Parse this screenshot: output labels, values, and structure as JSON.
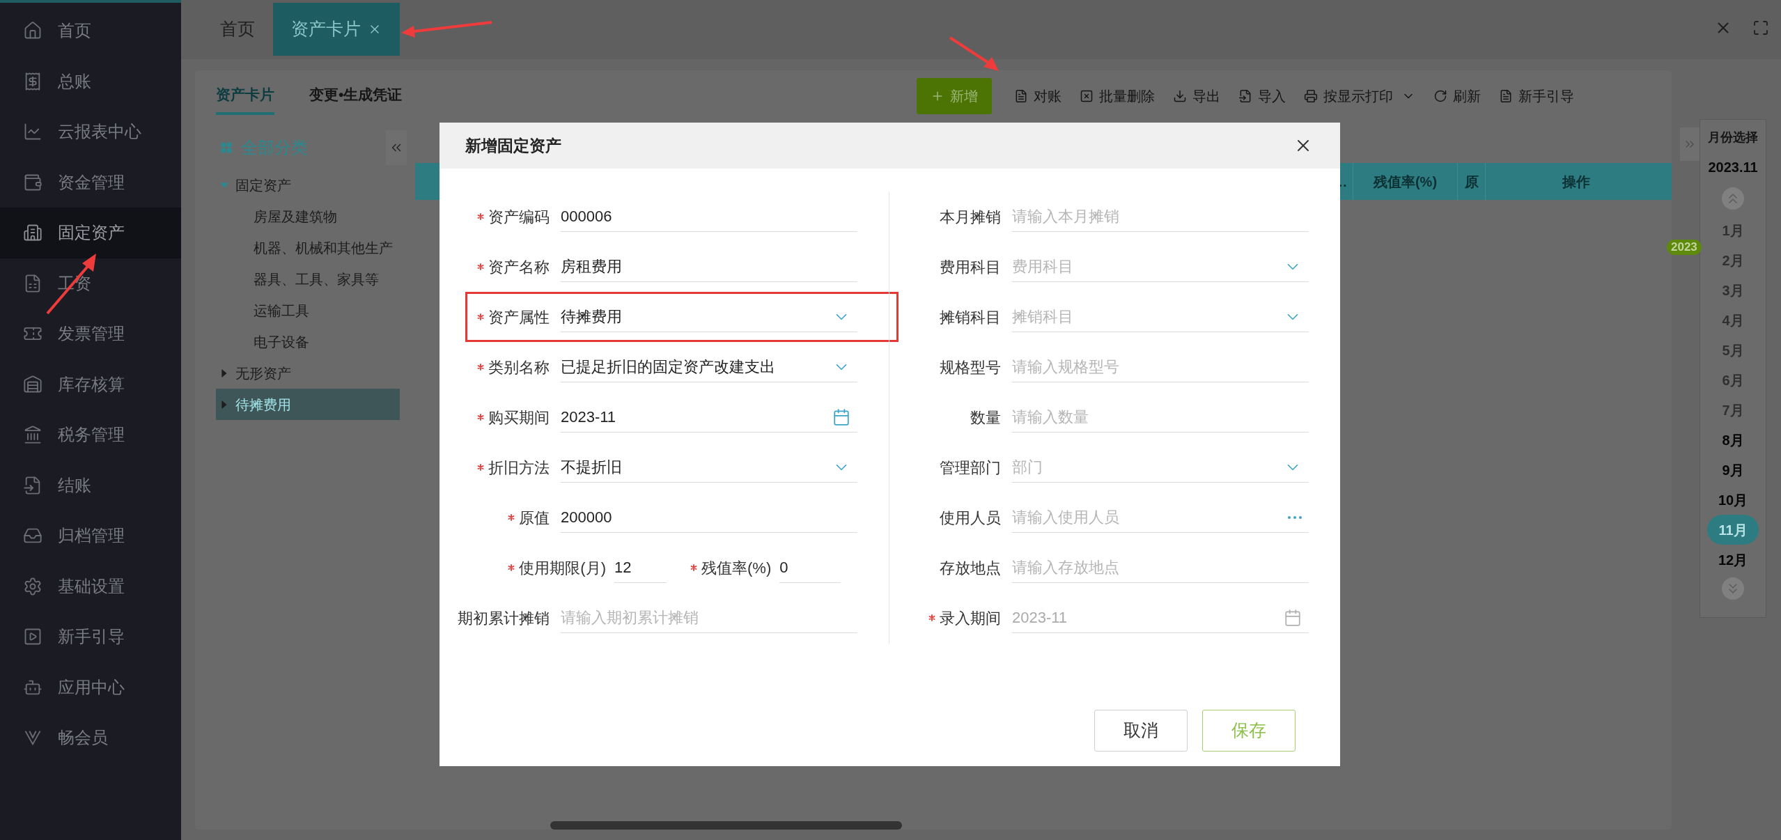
{
  "sidebar": {
    "items": [
      {
        "label": "首页",
        "selected": false
      },
      {
        "label": "总账",
        "selected": false
      },
      {
        "label": "云报表中心",
        "selected": false
      },
      {
        "label": "资金管理",
        "selected": false
      },
      {
        "label": "固定资产",
        "selected": true
      },
      {
        "label": "工资",
        "selected": false
      },
      {
        "label": "发票管理",
        "selected": false
      },
      {
        "label": "库存核算",
        "selected": false
      },
      {
        "label": "税务管理",
        "selected": false
      },
      {
        "label": "结账",
        "selected": false
      },
      {
        "label": "归档管理",
        "selected": false
      },
      {
        "label": "基础设置",
        "selected": false
      },
      {
        "label": "新手引导",
        "selected": false
      },
      {
        "label": "应用中心",
        "selected": false
      },
      {
        "label": "畅会员",
        "selected": false
      }
    ]
  },
  "top_tabs": [
    {
      "label": "首页",
      "selected": false,
      "closable": false
    },
    {
      "label": "资产卡片",
      "selected": true,
      "closable": true
    }
  ],
  "sub_tabs": [
    {
      "label": "资产卡片",
      "selected": true
    },
    {
      "label": "变更•生成凭证",
      "selected": false
    }
  ],
  "toolbar": [
    {
      "label": "新增",
      "kind": "primary"
    },
    {
      "label": "对账",
      "kind": "plain"
    },
    {
      "label": "批量删除",
      "kind": "plain"
    },
    {
      "label": "导出",
      "kind": "plain"
    },
    {
      "label": "导入",
      "kind": "plain"
    },
    {
      "label": "按显示打印",
      "kind": "menu"
    },
    {
      "label": "刷新",
      "kind": "plain"
    },
    {
      "label": "新手引导",
      "kind": "plain"
    }
  ],
  "category_tree": {
    "title": "全部分类",
    "items": [
      {
        "label": "固定资产",
        "expanded": true,
        "selected": false,
        "children": [
          {
            "label": "房屋及建筑物",
            "selected": false
          },
          {
            "label": "机器、机械和其他生产",
            "selected": false
          },
          {
            "label": "器具、工具、家具等",
            "selected": false
          },
          {
            "label": "运输工具",
            "selected": false
          },
          {
            "label": "电子设备",
            "selected": false
          }
        ]
      },
      {
        "label": "无形资产",
        "expanded": false,
        "selected": false
      },
      {
        "label": "待摊费用",
        "expanded": false,
        "selected": true
      }
    ]
  },
  "table": {
    "columns": [
      "…",
      "残值率(%)",
      "原",
      "操作"
    ]
  },
  "month_picker": {
    "title": "月份选择",
    "value": "2023.11",
    "year": "2023",
    "months": [
      {
        "label": "1月",
        "selected": false,
        "disabled": true
      },
      {
        "label": "2月",
        "selected": false,
        "disabled": true
      },
      {
        "label": "3月",
        "selected": false,
        "disabled": true
      },
      {
        "label": "4月",
        "selected": false,
        "disabled": true
      },
      {
        "label": "5月",
        "selected": false,
        "disabled": true
      },
      {
        "label": "6月",
        "selected": false,
        "disabled": true
      },
      {
        "label": "7月",
        "selected": false,
        "disabled": true
      },
      {
        "label": "8月",
        "selected": false,
        "disabled": false
      },
      {
        "label": "9月",
        "selected": false,
        "disabled": false
      },
      {
        "label": "10月",
        "selected": false,
        "disabled": false
      },
      {
        "label": "11月",
        "selected": true,
        "disabled": false
      },
      {
        "label": "12月",
        "selected": false,
        "disabled": false
      }
    ]
  },
  "dialog": {
    "title": "新增固定资产",
    "left_fields": [
      {
        "kind": "text",
        "label": "资产编码",
        "value": "000006",
        "required": true,
        "disabled": false,
        "highlighted": false
      },
      {
        "kind": "text",
        "label": "资产名称",
        "value": "房租费用",
        "required": true,
        "disabled": false,
        "highlighted": false
      },
      {
        "kind": "select",
        "label": "资产属性",
        "value": "待摊费用",
        "required": true,
        "disabled": false,
        "highlighted": true
      },
      {
        "kind": "select",
        "label": "类别名称",
        "value": "已提足折旧的固定资产改建支出",
        "required": true,
        "disabled": false,
        "highlighted": false
      },
      {
        "kind": "date",
        "label": "购买期间",
        "value": "2023-11",
        "required": true,
        "disabled": false,
        "highlighted": false
      },
      {
        "kind": "select",
        "label": "折旧方法",
        "value": "不提折旧",
        "required": true,
        "disabled": false,
        "highlighted": false
      },
      {
        "kind": "text",
        "label": "原值",
        "value": "200000",
        "required": true,
        "disabled": false,
        "highlighted": false
      },
      {
        "kind": "pair",
        "highlighted": false,
        "fields": [
          {
            "label": "使用期限(月)",
            "value": "12",
            "required": true
          },
          {
            "label": "残值率(%)",
            "value": "0",
            "required": true
          }
        ]
      },
      {
        "kind": "text",
        "label": "期初累计摊销",
        "placeholder": "请输入期初累计摊销",
        "required": false,
        "disabled": false,
        "highlighted": false
      }
    ],
    "right_fields": [
      {
        "kind": "text",
        "label": "本月摊销",
        "placeholder": "请输入本月摊销",
        "required": false,
        "disabled": false,
        "highlighted": false
      },
      {
        "kind": "select",
        "label": "费用科目",
        "placeholder": "费用科目",
        "required": false,
        "disabled": false,
        "highlighted": false
      },
      {
        "kind": "select",
        "label": "摊销科目",
        "placeholder": "摊销科目",
        "required": false,
        "disabled": false,
        "highlighted": false
      },
      {
        "kind": "text",
        "label": "规格型号",
        "placeholder": "请输入规格型号",
        "required": false,
        "disabled": false,
        "highlighted": false
      },
      {
        "kind": "text",
        "label": "数量",
        "placeholder": "请输入数量",
        "required": false,
        "disabled": false,
        "highlighted": false
      },
      {
        "kind": "select",
        "label": "管理部门",
        "placeholder": "部门",
        "required": false,
        "disabled": false,
        "highlighted": false
      },
      {
        "kind": "picker",
        "label": "使用人员",
        "placeholder": "请输入使用人员",
        "required": false,
        "disabled": false,
        "highlighted": false
      },
      {
        "kind": "text",
        "label": "存放地点",
        "placeholder": "请输入存放地点",
        "required": false,
        "disabled": false,
        "highlighted": false
      },
      {
        "kind": "date",
        "label": "录入期间",
        "value": "2023-11",
        "required": true,
        "disabled": true,
        "highlighted": false
      }
    ],
    "buttons": [
      {
        "label": "取消",
        "kind": "default"
      },
      {
        "label": "保存",
        "kind": "primary"
      }
    ]
  }
}
